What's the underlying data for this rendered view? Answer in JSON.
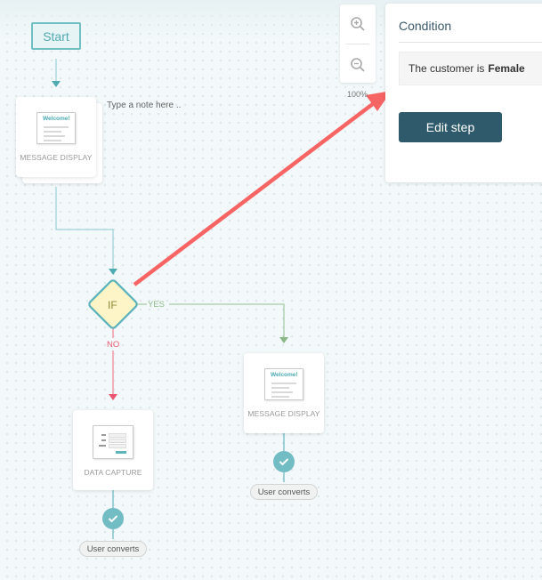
{
  "canvas": {
    "start_label": "Start",
    "note_placeholder": "Type a note here ..",
    "zoom_level": "100%",
    "zoom_in_icon": "zoom-in-icon",
    "zoom_out_icon": "zoom-out-icon"
  },
  "nodes": {
    "message_display_1": {
      "label": "MESSAGE DISPLAY",
      "thumb_text": "Welcome!"
    },
    "if_node": {
      "label": "IF",
      "yes_label": "YES",
      "no_label": "NO"
    },
    "data_capture": {
      "label": "DATA CAPTURE"
    },
    "message_display_2": {
      "label": "MESSAGE DISPLAY",
      "thumb_text": "Welcome!"
    },
    "goal_no_branch": {
      "label": "User converts",
      "icon": "check-icon"
    },
    "goal_yes_branch": {
      "label": "User converts",
      "icon": "check-icon"
    }
  },
  "condition_panel": {
    "title": "Condition",
    "condition_prefix": "The customer is",
    "condition_value": "Female",
    "edit_button": "Edit step"
  },
  "colors": {
    "flow_line": "#8fd0d6",
    "yes_line": "#9cc79a",
    "no_line": "#f07a8c",
    "annotation_arrow": "#f76464",
    "edit_button": "#2e5a6b",
    "if_fill": "#fdf4c8",
    "if_border": "#5bb2ba"
  }
}
